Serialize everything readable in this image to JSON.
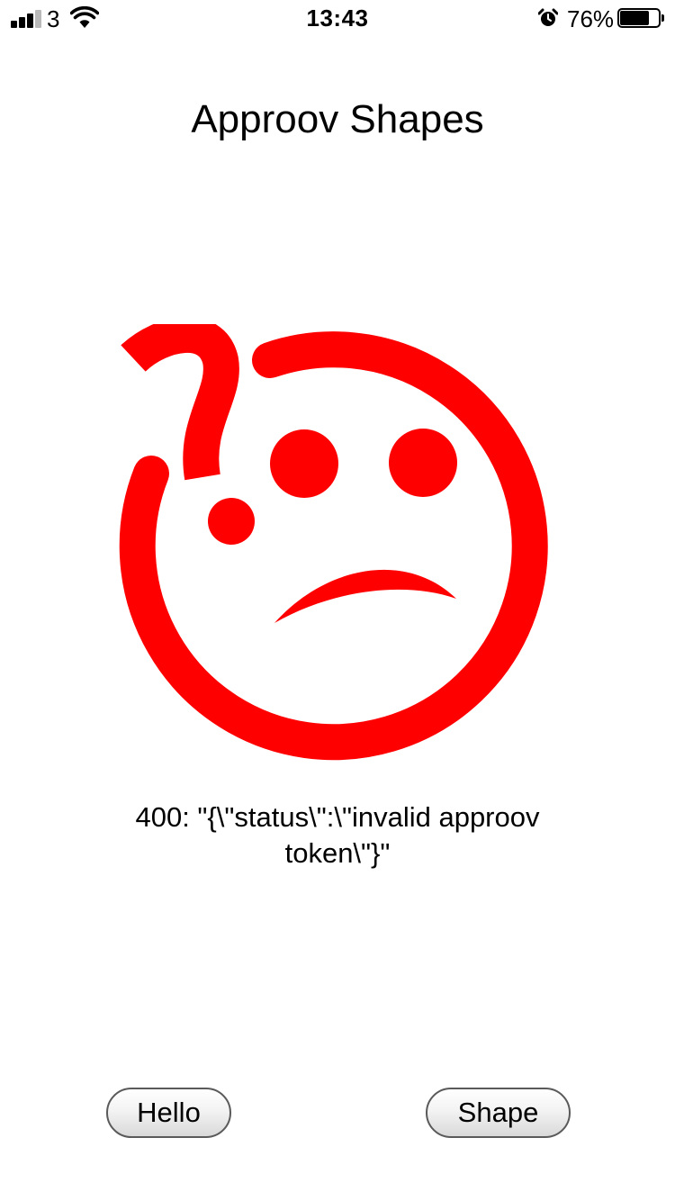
{
  "status_bar": {
    "carrier": "3",
    "time": "13:43",
    "battery_percent": "76%",
    "battery_level": 0.76,
    "signal_bars_filled": 3,
    "signal_bars_total": 4,
    "icons": [
      "signal-icon",
      "wifi-icon",
      "alarm-icon",
      "battery-icon"
    ]
  },
  "app": {
    "title": "Approov Shapes"
  },
  "result": {
    "image": "confused-sad-face",
    "image_color": "#ff0000",
    "message": "400: \"{\\\"status\\\":\\\"invalid approov token\\\"}\""
  },
  "buttons": {
    "hello_label": "Hello",
    "shape_label": "Shape"
  }
}
